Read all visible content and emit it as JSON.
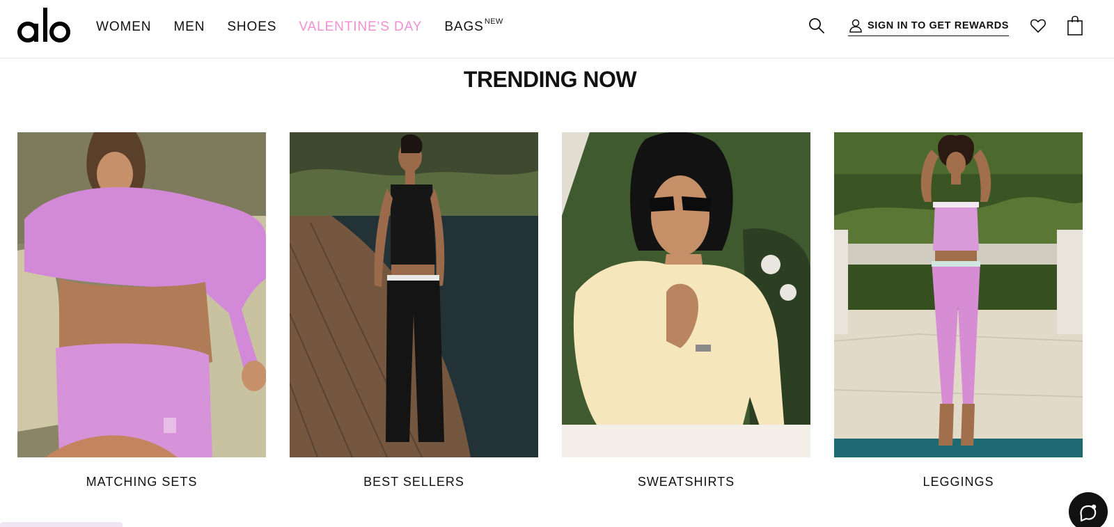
{
  "brand": {
    "logo_text": "alo"
  },
  "nav": {
    "items": [
      {
        "label": "WOMEN"
      },
      {
        "label": "MEN"
      },
      {
        "label": "SHOES"
      },
      {
        "label": "VALENTINE'S DAY",
        "color": "#f28fd2"
      },
      {
        "label": "BAGS",
        "badge": "NEW"
      }
    ]
  },
  "utility": {
    "search_icon": "search-icon",
    "signin_label": "SIGN IN TO GET REWARDS",
    "user_icon": "user-icon",
    "wishlist_icon": "heart-icon",
    "bag_icon": "shopping-bag-icon"
  },
  "section": {
    "title": "TRENDING NOW",
    "cards": [
      {
        "label": "MATCHING SETS"
      },
      {
        "label": "BEST SELLERS"
      },
      {
        "label": "SWEATSHIRTS"
      },
      {
        "label": "LEGGINGS"
      }
    ]
  },
  "chat": {
    "icon": "chat-bubble-icon"
  },
  "colors": {
    "accent_pink": "#f28fd2",
    "text": "#111111",
    "divider": "#e6e6e6"
  }
}
